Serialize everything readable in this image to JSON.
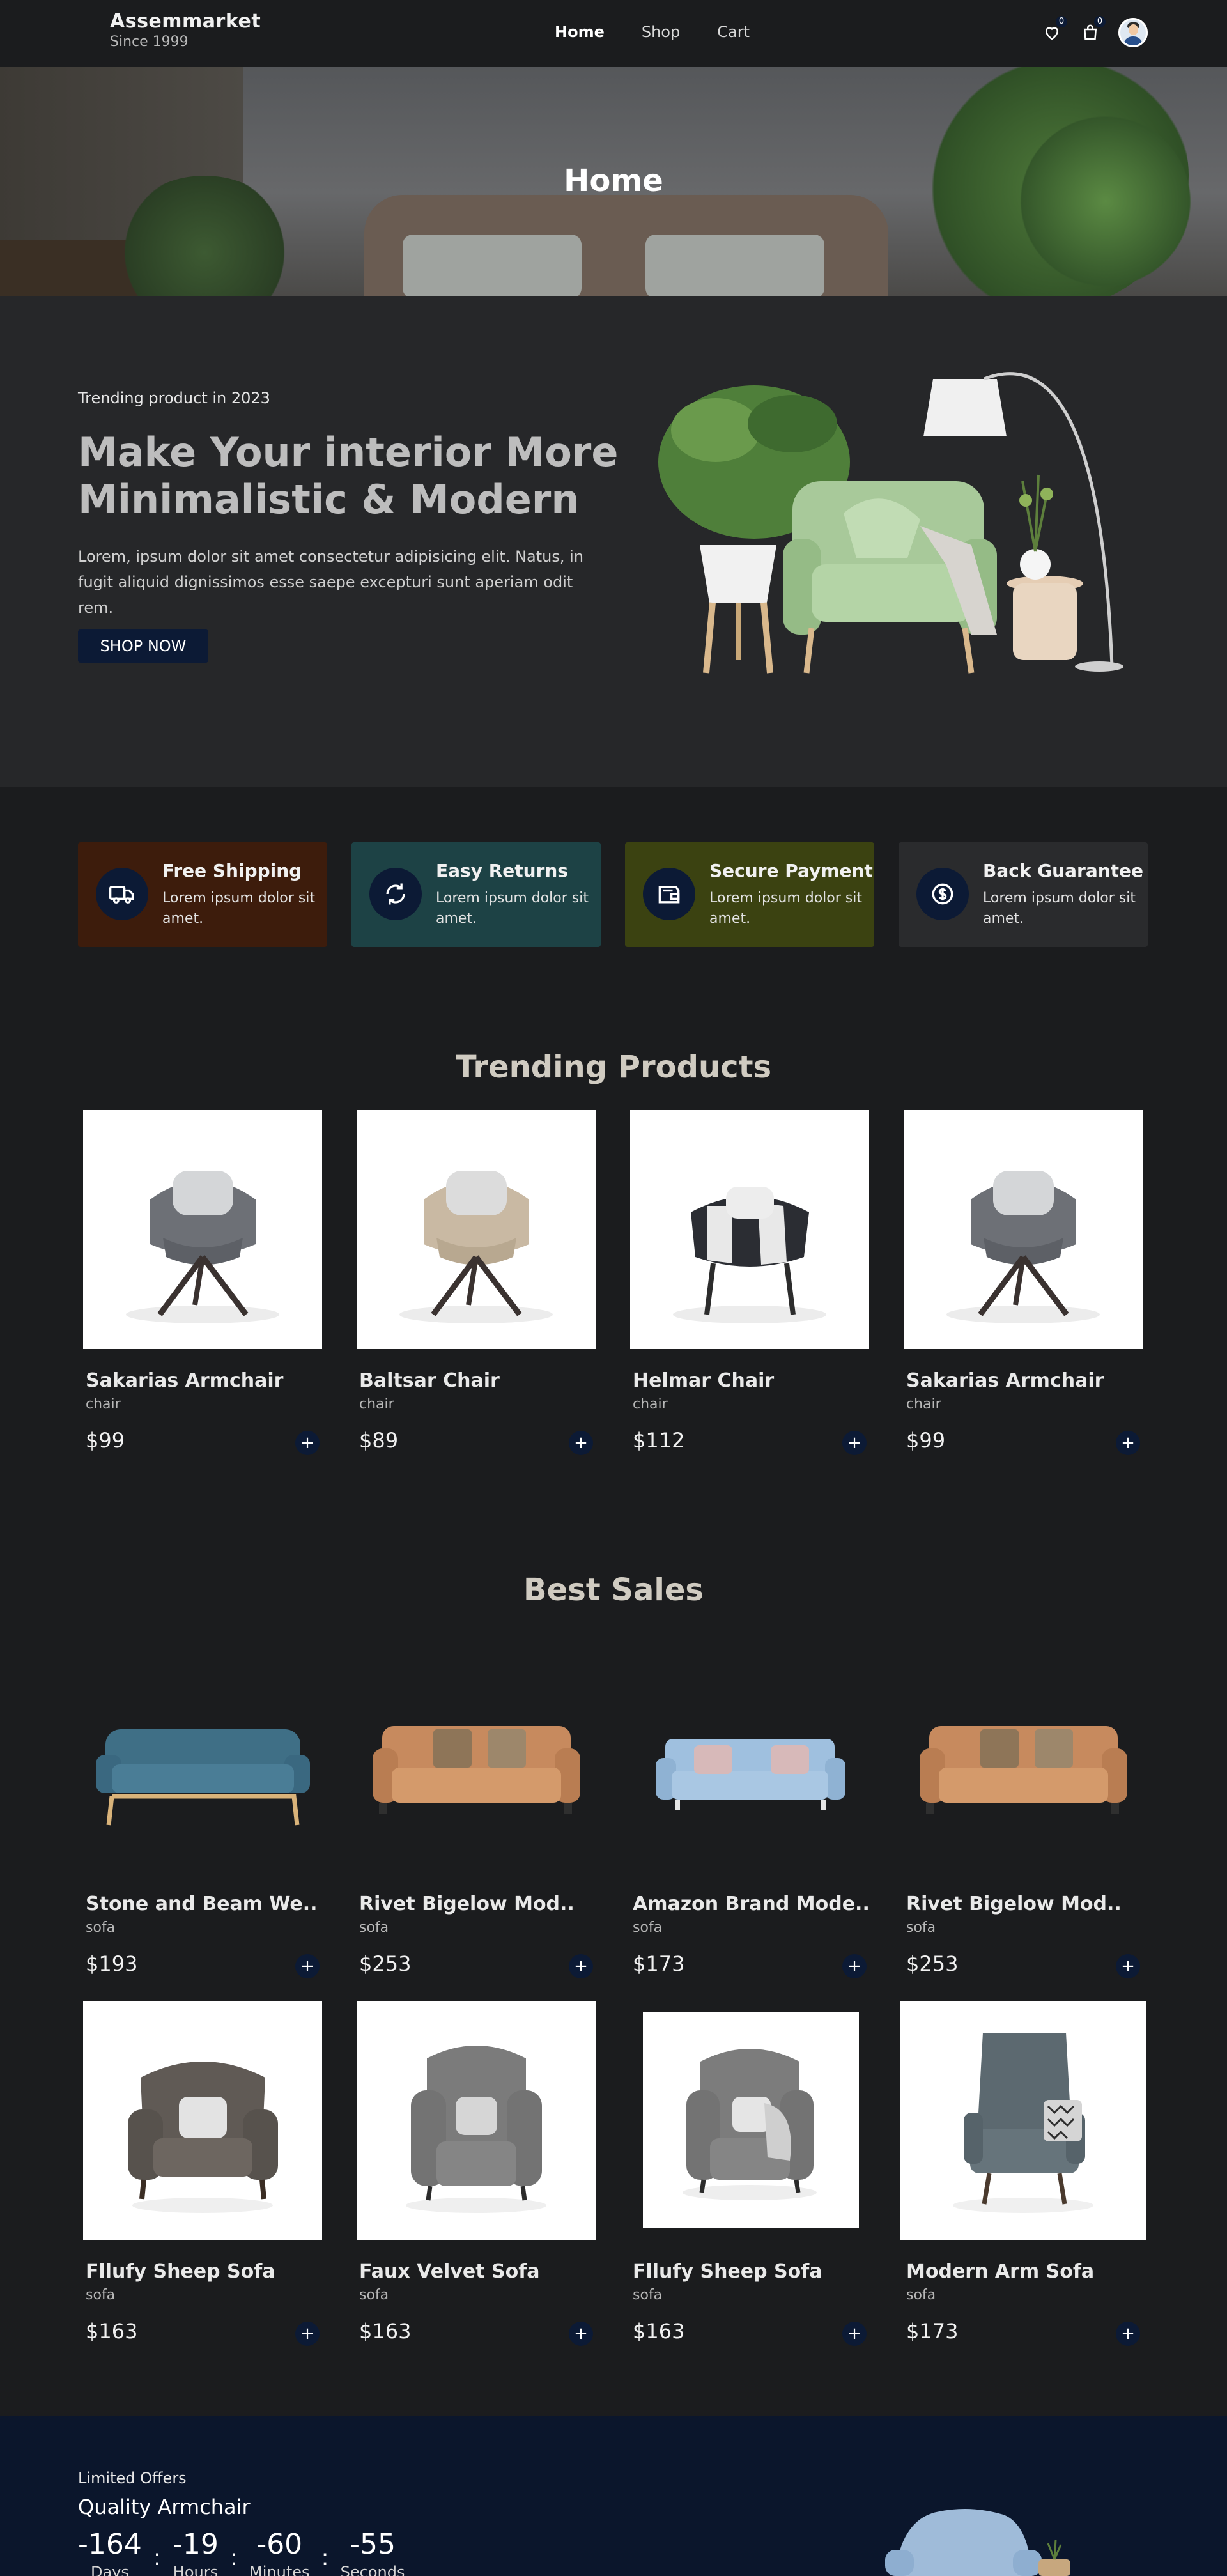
{
  "navbar": {
    "brand": "Assemmarket",
    "tagline": "Since 1999",
    "links": [
      "Home",
      "Shop",
      "Cart"
    ],
    "wishlist_count": "0",
    "cart_count": "0"
  },
  "banner": {
    "title": "Home"
  },
  "hero": {
    "kicker": "Trending product in 2023",
    "title": "Make Your interior More Minimalistic & Modern",
    "description": "Lorem, ipsum dolor sit amet consectetur adipisicing elit. Natus, in fugit aliquid dignissimos esse saepe excepturi sunt aperiam odit rem.",
    "button": "SHOP NOW"
  },
  "features": [
    {
      "title": "Free Shipping",
      "text": "Lorem ipsum dolor sit amet.",
      "icon": "truck-icon",
      "color": "#3d1c0c"
    },
    {
      "title": "Easy Returns",
      "text": "Lorem ipsum dolor sit amet.",
      "icon": "refresh-icon",
      "color": "#1d4245"
    },
    {
      "title": "Secure Payment",
      "text": "Lorem ipsum dolor sit amet.",
      "icon": "wallet-icon",
      "color": "#3b4211"
    },
    {
      "title": "Back Guarantee",
      "text": "Lorem ipsum dolor sit amet.",
      "icon": "money-back-icon",
      "color": "#2a2b2d"
    }
  ],
  "trending": {
    "title": "Trending Products",
    "products": [
      {
        "name": "Sakarias Armchair",
        "category": "chair",
        "price": "$99"
      },
      {
        "name": "Baltsar Chair",
        "category": "chair",
        "price": "$89"
      },
      {
        "name": "Helmar Chair",
        "category": "chair",
        "price": "$112"
      },
      {
        "name": "Sakarias Armchair",
        "category": "chair",
        "price": "$99"
      }
    ]
  },
  "best_sales": {
    "title": "Best Sales",
    "products": [
      {
        "name": "Stone and Beam We..",
        "category": "sofa",
        "price": "$193"
      },
      {
        "name": "Rivet Bigelow Mod..",
        "category": "sofa",
        "price": "$253"
      },
      {
        "name": "Amazon Brand Mode..",
        "category": "sofa",
        "price": "$173"
      },
      {
        "name": "Rivet Bigelow Mod..",
        "category": "sofa",
        "price": "$253"
      },
      {
        "name": "Fllufy Sheep Sofa",
        "category": "sofa",
        "price": "$163"
      },
      {
        "name": "Faux Velvet Sofa",
        "category": "sofa",
        "price": "$163"
      },
      {
        "name": "Fllufy Sheep Sofa",
        "category": "sofa",
        "price": "$163"
      },
      {
        "name": "Modern Arm Sofa",
        "category": "sofa",
        "price": "$173"
      }
    ]
  },
  "offer": {
    "kicker": "Limited Offers",
    "title": "Quality Armchair",
    "countdown": [
      {
        "value": "-164",
        "label": "Days"
      },
      {
        "value": "-19",
        "label": "Hours"
      },
      {
        "value": "-60",
        "label": "Minutes"
      },
      {
        "value": "-55",
        "label": "Seconds"
      }
    ]
  },
  "add_button_label": "+",
  "colors": {
    "accent": "#0c1a35",
    "page_bg": "#1b1c1e",
    "hero_bg": "#262729",
    "heading": "#d0cbc1"
  }
}
